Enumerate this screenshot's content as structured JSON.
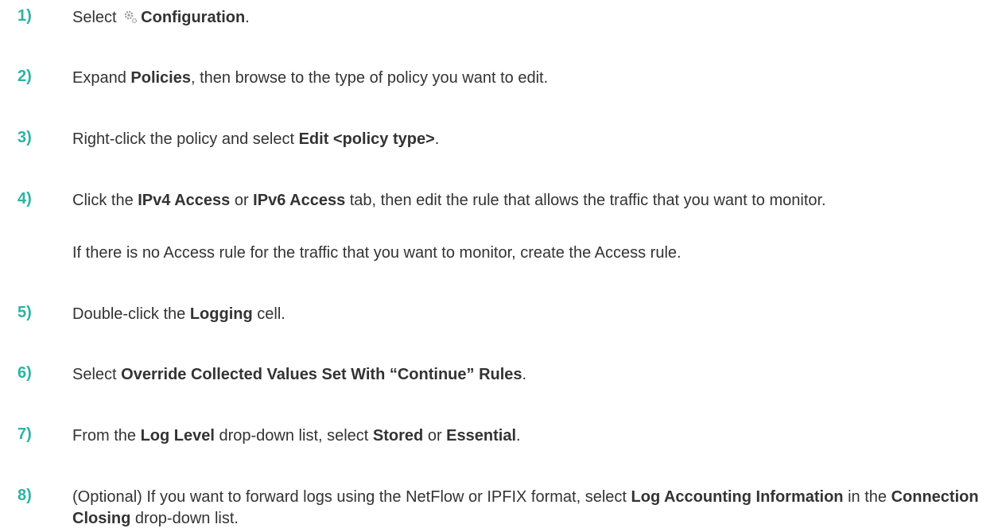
{
  "steps": [
    {
      "number": "1)",
      "parts": [
        {
          "t": "Select "
        },
        {
          "icon": "gear-icon"
        },
        {
          "t": "Configuration",
          "b": true
        },
        {
          "t": "."
        }
      ]
    },
    {
      "number": "2)",
      "parts": [
        {
          "t": "Expand "
        },
        {
          "t": "Policies",
          "b": true
        },
        {
          "t": ", then browse to the type of policy you want to edit."
        }
      ]
    },
    {
      "number": "3)",
      "parts": [
        {
          "t": "Right-click the policy and select "
        },
        {
          "t": "Edit <policy type>",
          "b": true
        },
        {
          "t": "."
        }
      ]
    },
    {
      "number": "4)",
      "parts": [
        {
          "t": "Click the "
        },
        {
          "t": "IPv4 Access",
          "b": true
        },
        {
          "t": " or "
        },
        {
          "t": "IPv6 Access",
          "b": true
        },
        {
          "t": " tab, then edit the rule that allows the traffic that you want to monitor."
        }
      ],
      "note": "If there is no Access rule for the traffic that you want to monitor, create the Access rule."
    },
    {
      "number": "5)",
      "parts": [
        {
          "t": "Double-click the "
        },
        {
          "t": "Logging",
          "b": true
        },
        {
          "t": " cell."
        }
      ]
    },
    {
      "number": "6)",
      "parts": [
        {
          "t": "Select "
        },
        {
          "t": "Override Collected Values Set With “Continue” Rules",
          "b": true
        },
        {
          "t": "."
        }
      ]
    },
    {
      "number": "7)",
      "parts": [
        {
          "t": "From the "
        },
        {
          "t": "Log Level",
          "b": true
        },
        {
          "t": " drop-down list, select "
        },
        {
          "t": "Stored",
          "b": true
        },
        {
          "t": " or "
        },
        {
          "t": "Essential",
          "b": true
        },
        {
          "t": "."
        }
      ]
    },
    {
      "number": "8)",
      "parts": [
        {
          "t": "(Optional) If you want to forward logs using the NetFlow or IPFIX format, select "
        },
        {
          "t": "Log Accounting Information",
          "b": true
        },
        {
          "t": " in the "
        },
        {
          "t": "Connection Closing",
          "b": true
        },
        {
          "t": " drop-down list."
        }
      ]
    }
  ],
  "colors": {
    "number": "#2bb3a4",
    "text": "#333333"
  }
}
